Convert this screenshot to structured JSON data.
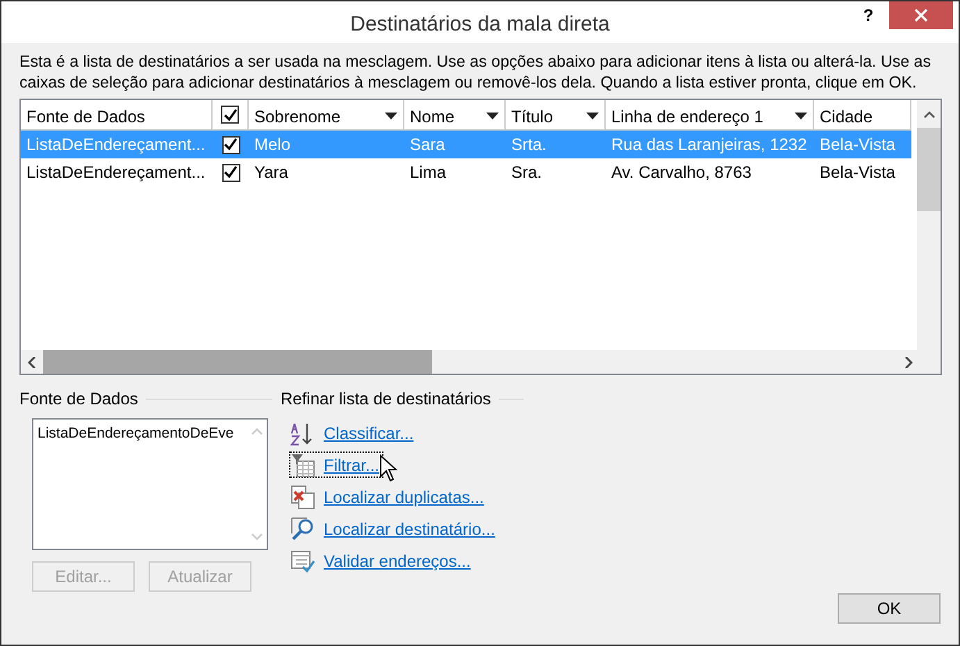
{
  "window": {
    "title": "Destinatários da mala direta",
    "help": "?"
  },
  "description": "Esta é a lista de destinatários a ser usada na mesclagem. Use as opções abaixo para adicionar itens à lista ou alterá-la. Use as caixas de seleção para adicionar destinatários à mesclagem ou removê-los dela. Quando a lista estiver pronta, clique em OK.",
  "table": {
    "header_checked": true,
    "columns": [
      {
        "label": "Fonte de Dados",
        "filter": false
      },
      {
        "label": "Sobrenome",
        "filter": true
      },
      {
        "label": "Nome",
        "filter": true
      },
      {
        "label": "Título",
        "filter": true
      },
      {
        "label": "Linha de endereço 1",
        "filter": true
      },
      {
        "label": "Cidade",
        "filter": false
      }
    ],
    "rows": [
      {
        "selected": true,
        "checked": true,
        "cells": [
          "ListaDeEndereçament...",
          "Melo",
          "Sara",
          "Srta.",
          "Rua das Laranjeiras, 1232",
          "Bela-Vista"
        ]
      },
      {
        "selected": false,
        "checked": true,
        "cells": [
          "ListaDeEndereçament...",
          "Yara",
          "Lima",
          "Sra.",
          "Av. Carvalho, 8763",
          "Bela-Vista"
        ]
      }
    ]
  },
  "data_source": {
    "label": "Fonte de Dados",
    "items": [
      "ListaDeEndereçamentoDeEve"
    ],
    "buttons": [
      {
        "label": "Editar...",
        "disabled": true
      },
      {
        "label": "Atualizar",
        "disabled": true
      }
    ]
  },
  "refine": {
    "label": "Refinar lista de destinatários",
    "links": [
      {
        "kind": "sort",
        "label": "Classificar...",
        "focused": false
      },
      {
        "kind": "filter",
        "label": "Filtrar...",
        "focused": true
      },
      {
        "kind": "duplicates",
        "label": "Localizar duplicatas...",
        "focused": false
      },
      {
        "kind": "find",
        "label": "Localizar destinatário...",
        "focused": false
      },
      {
        "kind": "validate",
        "label": "Validar endereços...",
        "focused": false
      }
    ]
  },
  "ok_button": "OK"
}
